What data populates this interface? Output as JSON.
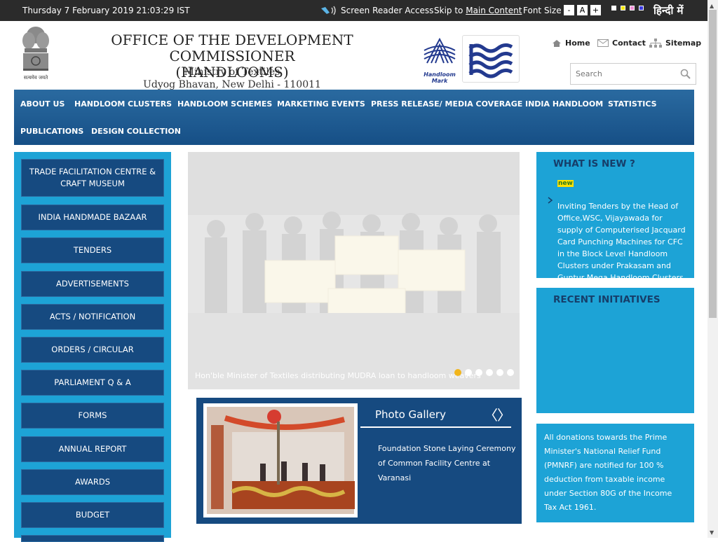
{
  "topbar": {
    "datetime": "Thursday 7 February 2019 21:03:29 IST",
    "screen_reader": "Screen Reader Access",
    "skip_to": "Skip to",
    "main_content": "Main Content",
    "font_size": "Font Size",
    "font_minus": "-",
    "font_normal": "A",
    "font_plus": "+",
    "theme_colors": [
      "#ffffff",
      "#f5e70d",
      "#f18fd6",
      "#3a3adf"
    ],
    "language": "हिन्दी में"
  },
  "header": {
    "emblem_motto": "सत्यमेव जयते",
    "org_line1": "OFFICE OF THE DEVELOPMENT COMMISSIONER",
    "org_line2": "(HANDLOOMS)",
    "ministry": "Ministry of Textiles",
    "address": "Udyog Bhavan, New Delhi - 110011",
    "handloom_mark_label": "Handloom Mark",
    "links": {
      "home": "Home",
      "contact": "Contact",
      "sitemap": "Sitemap"
    },
    "search_placeholder": "Search"
  },
  "nav": {
    "items": [
      "ABOUT US",
      "HANDLOOM CLUSTERS",
      "HANDLOOM SCHEMES",
      "MARKETING EVENTS",
      "PRESS RELEASE/ MEDIA COVERAGE",
      "INDIA HANDLOOM",
      "STATISTICS",
      "PUBLICATIONS",
      "DESIGN COLLECTION"
    ]
  },
  "sidebar": {
    "items": [
      {
        "label": "TRADE FACILITATION CENTRE & CRAFT MUSEUM"
      },
      {
        "label": "INDIA HANDMADE BAZAAR"
      },
      {
        "label": "TENDERS"
      },
      {
        "label": "ADVERTISEMENTS"
      },
      {
        "label": "ACTS / NOTIFICATION"
      },
      {
        "label": "ORDERS / CIRCULAR"
      },
      {
        "label": "PARLIAMENT Q & A"
      },
      {
        "label": "FORMS"
      },
      {
        "label": "ANNUAL REPORT"
      },
      {
        "label": "AWARDS"
      },
      {
        "label": "BUDGET"
      }
    ]
  },
  "slider": {
    "caption": "Hon'ble Minister of Textiles distributing MUDRA loan to handloom weavers",
    "active_slide": 1,
    "slide_count": 6
  },
  "gallery": {
    "title": "Photo Gallery",
    "prev": "〈",
    "next": "〉",
    "description": "Foundation Stone Laying Ceremony of Common Facility Centre at Varanasi"
  },
  "whats_new": {
    "heading": "WHAT IS NEW ?",
    "new_badge": "new",
    "items": [
      "Inviting Tenders by the Head of Office,WSC, Vijayawada for supply of Computerised Jacquard Card Punching Machines for CFC in the Block Level Handloom Clusters under Prakasam and Guntur Mega Handloom Clusters"
    ]
  },
  "recent": {
    "heading": "RECENT INITIATIVES"
  },
  "donation": {
    "text": "All donations towards the Prime Minister's National Relief Fund (PMNRF) are notified for 100 % deduction from taxable income under Section 80G of the Income Tax Act 1961."
  },
  "colors": {
    "topbar": "#2b2b2b",
    "nav": "#164f86",
    "panel": "#1da3d6",
    "button": "#164a80",
    "heading": "#163e6a",
    "active_dot": "#f1b51c"
  }
}
